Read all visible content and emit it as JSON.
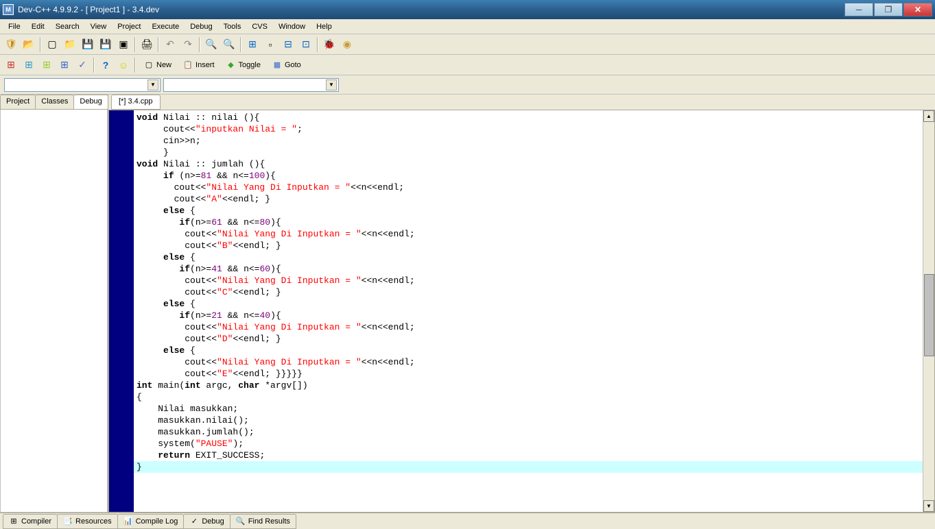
{
  "window": {
    "title": "Dev-C++ 4.9.9.2  -  [ Project1 ] - 3.4.dev",
    "icon_letter": "M"
  },
  "menu": [
    "File",
    "Edit",
    "Search",
    "View",
    "Project",
    "Execute",
    "Debug",
    "Tools",
    "CVS",
    "Window",
    "Help"
  ],
  "toolbar2_buttons": [
    {
      "label": "New"
    },
    {
      "label": "Insert"
    },
    {
      "label": "Toggle"
    },
    {
      "label": "Goto"
    }
  ],
  "sidebar_tabs": [
    "Project",
    "Classes",
    "Debug"
  ],
  "active_sidebar_tab": "Debug",
  "editor_tab": "[*] 3.4.cpp",
  "code_lines": [
    {
      "t": "void Nilai :: nilai (){",
      "i": 0,
      "tokens": [
        {
          "k": "kw",
          "v": "void"
        },
        {
          "k": "pl",
          "v": " Nilai :: nilai (){"
        }
      ]
    },
    {
      "t": "     cout<<\"inputkan Nilai = \";",
      "i": 1,
      "tokens": [
        {
          "k": "pl",
          "v": "     cout<<"
        },
        {
          "k": "str",
          "v": "\"inputkan Nilai = \""
        },
        {
          "k": "pl",
          "v": ";"
        }
      ]
    },
    {
      "t": "     cin>>n;",
      "i": 1,
      "tokens": [
        {
          "k": "pl",
          "v": "     cin>>n;"
        }
      ]
    },
    {
      "t": "     }",
      "i": 1,
      "tokens": [
        {
          "k": "pl",
          "v": "     }"
        }
      ]
    },
    {
      "t": "void Nilai :: jumlah (){",
      "i": 0,
      "tokens": [
        {
          "k": "kw",
          "v": "void"
        },
        {
          "k": "pl",
          "v": " Nilai :: jumlah (){"
        }
      ]
    },
    {
      "t": "     if (n>=81 && n<=100){",
      "i": 1,
      "tokens": [
        {
          "k": "pl",
          "v": "     "
        },
        {
          "k": "kw",
          "v": "if"
        },
        {
          "k": "pl",
          "v": " (n>="
        },
        {
          "k": "num",
          "v": "81"
        },
        {
          "k": "pl",
          "v": " && n<="
        },
        {
          "k": "num",
          "v": "100"
        },
        {
          "k": "pl",
          "v": "){"
        }
      ]
    },
    {
      "t": "       cout<<\"Nilai Yang Di Inputkan = \"<<n<<endl;",
      "i": 1,
      "tokens": [
        {
          "k": "pl",
          "v": "       cout<<"
        },
        {
          "k": "str",
          "v": "\"Nilai Yang Di Inputkan = \""
        },
        {
          "k": "pl",
          "v": "<<n<<endl;"
        }
      ]
    },
    {
      "t": "       cout<<\"A\"<<endl; }",
      "i": 1,
      "tokens": [
        {
          "k": "pl",
          "v": "       cout<<"
        },
        {
          "k": "str",
          "v": "\"A\""
        },
        {
          "k": "pl",
          "v": "<<endl; }"
        }
      ]
    },
    {
      "t": "     else {",
      "i": 1,
      "tokens": [
        {
          "k": "pl",
          "v": "     "
        },
        {
          "k": "kw",
          "v": "else"
        },
        {
          "k": "pl",
          "v": " {"
        }
      ]
    },
    {
      "t": "        if(n>=61 && n<=80){",
      "i": 1,
      "tokens": [
        {
          "k": "pl",
          "v": "        "
        },
        {
          "k": "kw",
          "v": "if"
        },
        {
          "k": "pl",
          "v": "(n>="
        },
        {
          "k": "num",
          "v": "61"
        },
        {
          "k": "pl",
          "v": " && n<="
        },
        {
          "k": "num",
          "v": "80"
        },
        {
          "k": "pl",
          "v": "){"
        }
      ]
    },
    {
      "t": "         cout<<\"Nilai Yang Di Inputkan = \"<<n<<endl;",
      "i": 1,
      "tokens": [
        {
          "k": "pl",
          "v": "         cout<<"
        },
        {
          "k": "str",
          "v": "\"Nilai Yang Di Inputkan = \""
        },
        {
          "k": "pl",
          "v": "<<n<<endl;"
        }
      ]
    },
    {
      "t": "         cout<<\"B\"<<endl; }",
      "i": 1,
      "tokens": [
        {
          "k": "pl",
          "v": "         cout<<"
        },
        {
          "k": "str",
          "v": "\"B\""
        },
        {
          "k": "pl",
          "v": "<<endl; }"
        }
      ]
    },
    {
      "t": "     else {",
      "i": 1,
      "tokens": [
        {
          "k": "pl",
          "v": "     "
        },
        {
          "k": "kw",
          "v": "else"
        },
        {
          "k": "pl",
          "v": " {"
        }
      ]
    },
    {
      "t": "        if(n>=41 && n<=60){",
      "i": 1,
      "tokens": [
        {
          "k": "pl",
          "v": "        "
        },
        {
          "k": "kw",
          "v": "if"
        },
        {
          "k": "pl",
          "v": "(n>="
        },
        {
          "k": "num",
          "v": "41"
        },
        {
          "k": "pl",
          "v": " && n<="
        },
        {
          "k": "num",
          "v": "60"
        },
        {
          "k": "pl",
          "v": "){"
        }
      ]
    },
    {
      "t": "         cout<<\"Nilai Yang Di Inputkan = \"<<n<<endl;",
      "i": 1,
      "tokens": [
        {
          "k": "pl",
          "v": "         cout<<"
        },
        {
          "k": "str",
          "v": "\"Nilai Yang Di Inputkan = \""
        },
        {
          "k": "pl",
          "v": "<<n<<endl;"
        }
      ]
    },
    {
      "t": "         cout<<\"C\"<<endl; }",
      "i": 1,
      "tokens": [
        {
          "k": "pl",
          "v": "         cout<<"
        },
        {
          "k": "str",
          "v": "\"C\""
        },
        {
          "k": "pl",
          "v": "<<endl; }"
        }
      ]
    },
    {
      "t": "     else {",
      "i": 1,
      "tokens": [
        {
          "k": "pl",
          "v": "     "
        },
        {
          "k": "kw",
          "v": "else"
        },
        {
          "k": "pl",
          "v": " {"
        }
      ]
    },
    {
      "t": "        if(n>=21 && n<=40){",
      "i": 1,
      "tokens": [
        {
          "k": "pl",
          "v": "        "
        },
        {
          "k": "kw",
          "v": "if"
        },
        {
          "k": "pl",
          "v": "(n>="
        },
        {
          "k": "num",
          "v": "21"
        },
        {
          "k": "pl",
          "v": " && n<="
        },
        {
          "k": "num",
          "v": "40"
        },
        {
          "k": "pl",
          "v": "){"
        }
      ]
    },
    {
      "t": "         cout<<\"Nilai Yang Di Inputkan = \"<<n<<endl;",
      "i": 1,
      "tokens": [
        {
          "k": "pl",
          "v": "         cout<<"
        },
        {
          "k": "str",
          "v": "\"Nilai Yang Di Inputkan = \""
        },
        {
          "k": "pl",
          "v": "<<n<<endl;"
        }
      ]
    },
    {
      "t": "         cout<<\"D\"<<endl; }",
      "i": 1,
      "tokens": [
        {
          "k": "pl",
          "v": "         cout<<"
        },
        {
          "k": "str",
          "v": "\"D\""
        },
        {
          "k": "pl",
          "v": "<<endl; }"
        }
      ]
    },
    {
      "t": "     else {",
      "i": 1,
      "tokens": [
        {
          "k": "pl",
          "v": "     "
        },
        {
          "k": "kw",
          "v": "else"
        },
        {
          "k": "pl",
          "v": " {"
        }
      ]
    },
    {
      "t": "         cout<<\"Nilai Yang Di Inputkan = \"<<n<<endl;",
      "i": 1,
      "tokens": [
        {
          "k": "pl",
          "v": "         cout<<"
        },
        {
          "k": "str",
          "v": "\"Nilai Yang Di Inputkan = \""
        },
        {
          "k": "pl",
          "v": "<<n<<endl;"
        }
      ]
    },
    {
      "t": "         cout<<\"E\"<<endl; }}}}}",
      "i": 1,
      "tokens": [
        {
          "k": "pl",
          "v": "         cout<<"
        },
        {
          "k": "str",
          "v": "\"E\""
        },
        {
          "k": "pl",
          "v": "<<endl; }}}}}"
        }
      ]
    },
    {
      "t": "int main(int argc, char *argv[])",
      "i": 0,
      "tokens": [
        {
          "k": "kw",
          "v": "int"
        },
        {
          "k": "pl",
          "v": " main("
        },
        {
          "k": "kw",
          "v": "int"
        },
        {
          "k": "pl",
          "v": " argc, "
        },
        {
          "k": "kw",
          "v": "char"
        },
        {
          "k": "pl",
          "v": " *argv[])"
        }
      ]
    },
    {
      "t": "{",
      "i": 0,
      "tokens": [
        {
          "k": "pl",
          "v": "{"
        }
      ]
    },
    {
      "t": "    Nilai masukkan;",
      "i": 0,
      "tokens": [
        {
          "k": "pl",
          "v": "    Nilai masukkan;"
        }
      ]
    },
    {
      "t": "    masukkan.nilai();",
      "i": 0,
      "tokens": [
        {
          "k": "pl",
          "v": "    masukkan.nilai();"
        }
      ]
    },
    {
      "t": "    masukkan.jumlah();",
      "i": 0,
      "tokens": [
        {
          "k": "pl",
          "v": "    masukkan.jumlah();"
        }
      ]
    },
    {
      "t": "    system(\"PAUSE\");",
      "i": 0,
      "tokens": [
        {
          "k": "pl",
          "v": "    system("
        },
        {
          "k": "str",
          "v": "\"PAUSE\""
        },
        {
          "k": "pl",
          "v": ");"
        }
      ]
    },
    {
      "t": "    return EXIT_SUCCESS;",
      "i": 0,
      "tokens": [
        {
          "k": "pl",
          "v": "    "
        },
        {
          "k": "kw",
          "v": "return"
        },
        {
          "k": "pl",
          "v": " EXIT_SUCCESS;"
        }
      ]
    },
    {
      "t": "}",
      "i": 0,
      "current": true,
      "tokens": [
        {
          "k": "pl",
          "v": "}"
        }
      ]
    }
  ],
  "status_tabs": [
    {
      "icon": "⊞",
      "label": "Compiler"
    },
    {
      "icon": "📑",
      "label": "Resources"
    },
    {
      "icon": "📊",
      "label": "Compile Log"
    },
    {
      "icon": "✓",
      "label": "Debug"
    },
    {
      "icon": "🔍",
      "label": "Find Results"
    }
  ]
}
